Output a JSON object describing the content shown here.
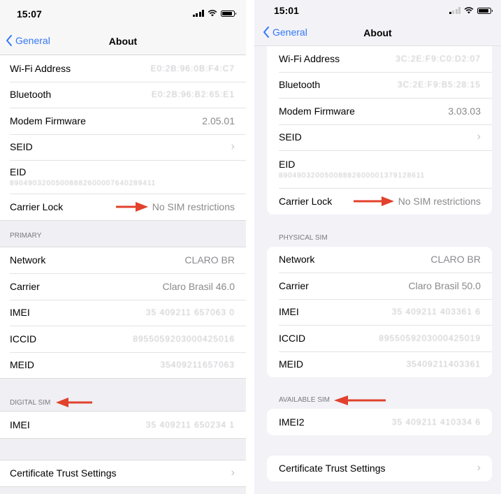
{
  "left": {
    "status": {
      "time": "15:07"
    },
    "nav": {
      "back_label": "General",
      "title": "About"
    },
    "top_rows": [
      {
        "label": "Wi-Fi Address",
        "value": "E0:2B:96:0B:F4:C7",
        "redacted": true
      },
      {
        "label": "Bluetooth",
        "value": "E0:2B:96:B2:65:E1",
        "redacted": true
      },
      {
        "label": "Modem Firmware",
        "value": "2.05.01",
        "redacted": false
      },
      {
        "label": "SEID",
        "chevron": "›"
      },
      {
        "label": "EID",
        "value": "89049032005008882600007640289411",
        "redacted": true
      },
      {
        "label": "Carrier Lock",
        "value": "No SIM restrictions",
        "annotated": true
      }
    ],
    "primary_header": "PRIMARY",
    "primary_rows": [
      {
        "label": "Network",
        "value": "CLARO BR",
        "redacted": false
      },
      {
        "label": "Carrier",
        "value": "Claro Brasil 46.0",
        "redacted": false
      },
      {
        "label": "IMEI",
        "value": "35 409211 657063 0",
        "redacted": true
      },
      {
        "label": "ICCID",
        "value": "8955059203000425016",
        "redacted": true
      },
      {
        "label": "MEID",
        "value": "35409211657063",
        "redacted": true
      }
    ],
    "digital_header": "DIGITAL SIM",
    "digital_rows": [
      {
        "label": "IMEI",
        "value": "35 409211 650234 1",
        "redacted": true
      }
    ],
    "cert_label": "Certificate Trust Settings",
    "chevron": "›"
  },
  "right": {
    "status": {
      "time": "15:01"
    },
    "nav": {
      "back_label": "General",
      "title": "About"
    },
    "top_rows": [
      {
        "label": "Wi-Fi Address",
        "value": "3C:2E:F9:C0:D2:07",
        "redacted": true
      },
      {
        "label": "Bluetooth",
        "value": "3C:2E:F9:B5:28:15",
        "redacted": true
      },
      {
        "label": "Modem Firmware",
        "value": "3.03.03",
        "redacted": false
      },
      {
        "label": "SEID",
        "chevron": "›"
      },
      {
        "label": "EID",
        "value": "89049032005008882600001379128611",
        "redacted": true
      },
      {
        "label": "Carrier Lock",
        "value": "No SIM restrictions",
        "annotated": true
      }
    ],
    "physical_header": "PHYSICAL SIM",
    "physical_rows": [
      {
        "label": "Network",
        "value": "CLARO BR",
        "redacted": false
      },
      {
        "label": "Carrier",
        "value": "Claro Brasil 50.0",
        "redacted": false
      },
      {
        "label": "IMEI",
        "value": "35 409211 403361 6",
        "redacted": true
      },
      {
        "label": "ICCID",
        "value": "8955059203000425019",
        "redacted": true
      },
      {
        "label": "MEID",
        "value": "35409211403361",
        "redacted": true
      }
    ],
    "available_header": "AVAILABLE SIM",
    "available_rows": [
      {
        "label": "IMEI2",
        "value": "35 409211 410334 6",
        "redacted": true
      }
    ],
    "cert_label": "Certificate Trust Settings",
    "chevron": "›"
  },
  "colors": {
    "accent": "#3478f6",
    "annotation_arrow": "#e2412c",
    "secondary_text": "#8a8a8e"
  }
}
